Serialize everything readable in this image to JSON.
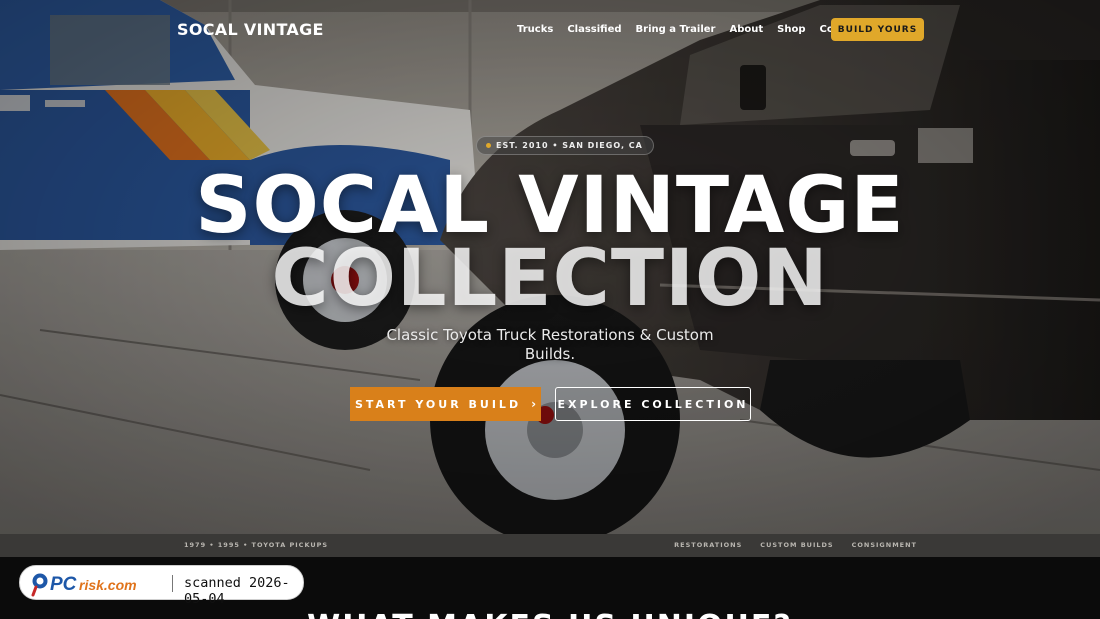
{
  "nav": {
    "brand": "SOCAL VINTAGE",
    "links": [
      "Trucks",
      "Classified",
      "Bring a Trailer",
      "About",
      "Shop",
      "Contact"
    ],
    "cta_label": "BUILD YOURS"
  },
  "hero": {
    "est_label": "EST. 2010 • SAN DIEGO, CA",
    "title_line1": "SOCAL VINTAGE",
    "title_line2": "COLLECTION",
    "subtitle": "Classic Toyota Truck Restorations & Custom Builds.",
    "primary_cta": "START YOUR BUILD",
    "secondary_cta": "EXPLORE COLLECTION",
    "background_image": "vintage-toyota-trucks"
  },
  "strip": {
    "left_text": "1979 • 1995 • TOYOTA PICKUPS",
    "right_items": [
      "RESTORATIONS",
      "CUSTOM BUILDS",
      "CONSIGNMENT"
    ]
  },
  "section": {
    "title": "WHAT MAKES US UNIQUE?"
  },
  "watermark": {
    "logo_text": "PCrisk.com",
    "scan_text": "scanned 2026-05-04"
  },
  "colors": {
    "accent_gold": "#e0a82a",
    "accent_orange": "#d9801a",
    "strip_bg": "#3a3937",
    "footer_bg": "#0b0b0b"
  },
  "icons": [
    "chevron-right-icon",
    "dot-icon",
    "pcrisk-logo-icon"
  ]
}
